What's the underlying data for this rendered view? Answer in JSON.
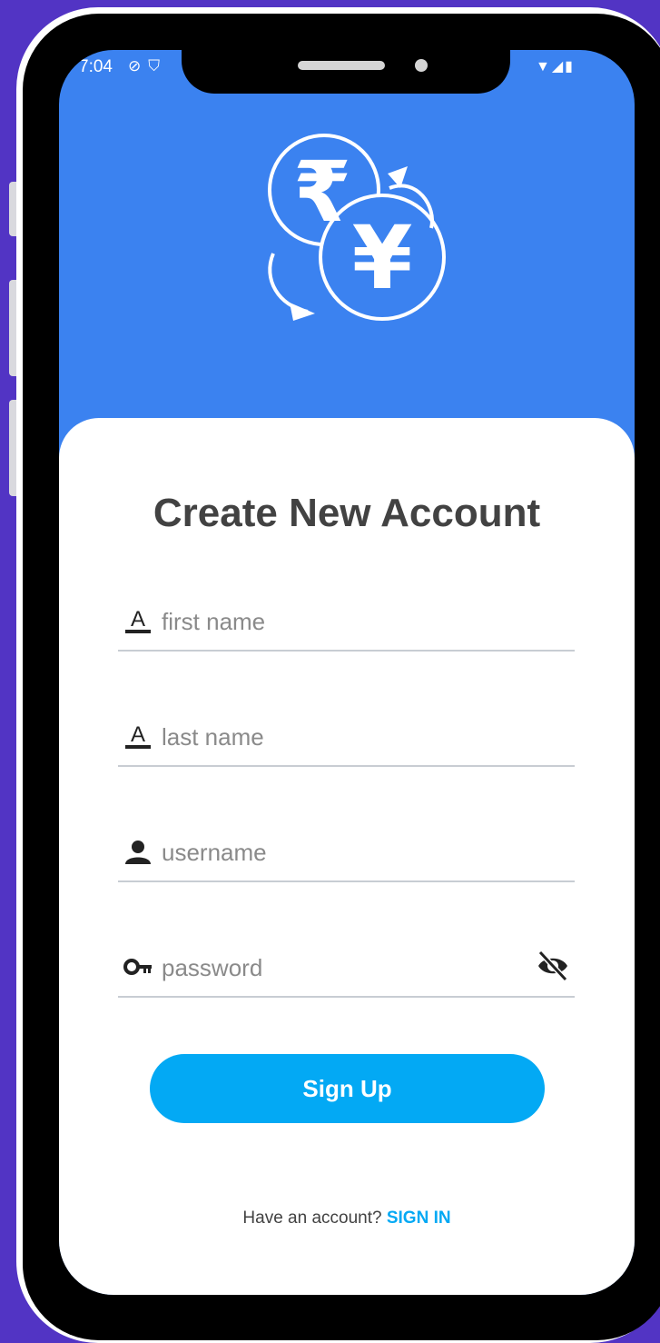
{
  "status_bar": {
    "time": "7:04",
    "left_icons": "vpn-icon shield-icon",
    "right_icons": "wifi-icon signal-icon battery-icon"
  },
  "header": {
    "logo_icon": "currency-exchange-icon",
    "background_color": "#3b82f0"
  },
  "form": {
    "title": "Create New Account",
    "fields": [
      {
        "icon": "text-format-icon",
        "placeholder": "first name"
      },
      {
        "icon": "text-format-icon",
        "placeholder": "last name"
      },
      {
        "icon": "person-icon",
        "placeholder": "username"
      },
      {
        "icon": "key-icon",
        "placeholder": "password",
        "toggle_icon": "visibility-off-icon"
      }
    ],
    "submit_label": "Sign Up",
    "submit_color": "#03a9f4",
    "footer_text": "Have an account?",
    "footer_link": "SIGN IN"
  }
}
